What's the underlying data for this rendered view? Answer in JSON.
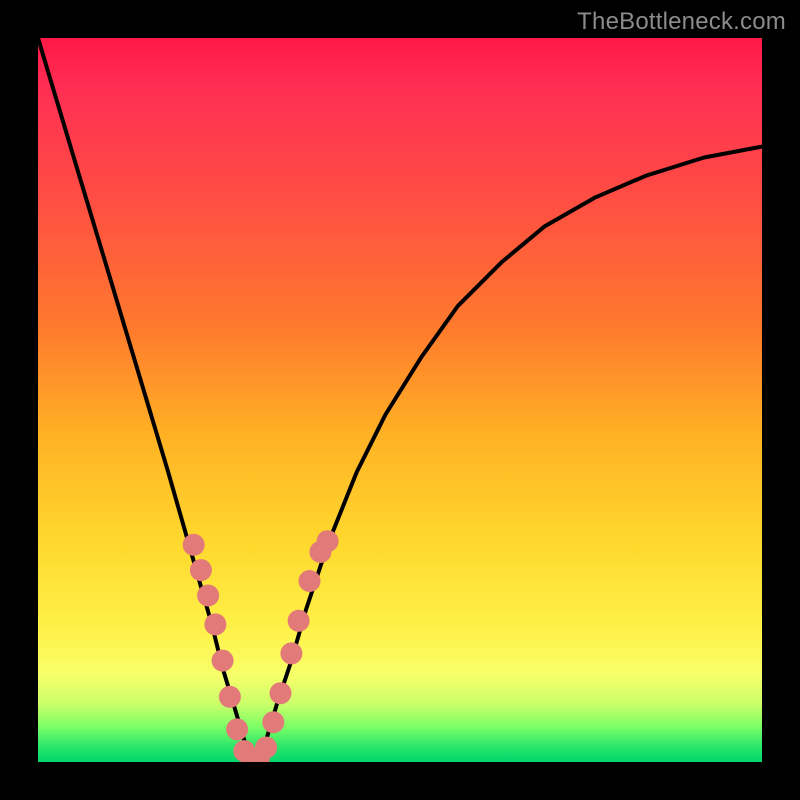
{
  "watermark": {
    "text": "TheBottleneck.com"
  },
  "chart_data": {
    "type": "line",
    "title": "",
    "xlabel": "",
    "ylabel": "",
    "xlim": [
      0,
      1
    ],
    "ylim": [
      0,
      100
    ],
    "series": [
      {
        "name": "curve",
        "x": [
          0.0,
          0.03,
          0.06,
          0.09,
          0.12,
          0.15,
          0.18,
          0.2,
          0.22,
          0.24,
          0.255,
          0.27,
          0.285,
          0.3,
          0.315,
          0.33,
          0.35,
          0.37,
          0.4,
          0.44,
          0.48,
          0.53,
          0.58,
          0.64,
          0.7,
          0.77,
          0.84,
          0.92,
          1.0
        ],
        "values": [
          100,
          90,
          80,
          70,
          60,
          50,
          40,
          33,
          26,
          19,
          13,
          8,
          3,
          0,
          3,
          8,
          14,
          21,
          30,
          40,
          48,
          56,
          63,
          69,
          74,
          78,
          81,
          83.5,
          85
        ]
      }
    ],
    "markers": {
      "name": "dots",
      "color": "#e37a7a",
      "radius_px": 11,
      "x": [
        0.215,
        0.225,
        0.235,
        0.245,
        0.255,
        0.265,
        0.275,
        0.285,
        0.295,
        0.305,
        0.315,
        0.325,
        0.335,
        0.35,
        0.36,
        0.375,
        0.39,
        0.4
      ],
      "values": [
        30,
        26.5,
        23,
        19,
        14,
        9,
        4.5,
        1.5,
        0,
        0.5,
        2,
        5.5,
        9.5,
        15,
        19.5,
        25,
        29,
        30.5
      ]
    },
    "gradient_meaning": "background hue indicates metric value vertically — red high, green low"
  }
}
